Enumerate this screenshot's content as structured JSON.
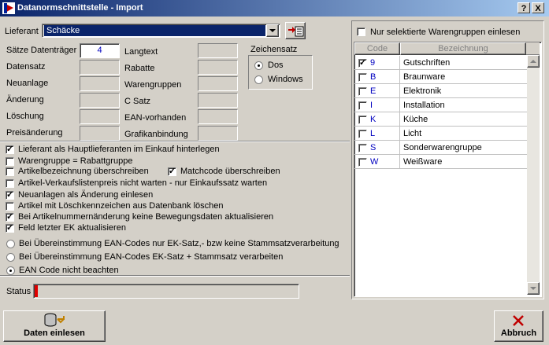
{
  "window": {
    "title": "Datanormschnittstelle - Import",
    "help": "?",
    "close": "X"
  },
  "supplier": {
    "label": "Lieferant",
    "value": "Schäcke"
  },
  "fields_left": [
    {
      "label": "Sätze Datenträger",
      "value": "4"
    },
    {
      "label": "Datensatz",
      "value": ""
    },
    {
      "label": "Neuanlage",
      "value": ""
    },
    {
      "label": "Änderung",
      "value": ""
    },
    {
      "label": "Löschung",
      "value": ""
    },
    {
      "label": "Preisänderung",
      "value": ""
    }
  ],
  "fields_right": [
    {
      "label": "Langtext",
      "value": ""
    },
    {
      "label": "Rabatte",
      "value": ""
    },
    {
      "label": "Warengruppen",
      "value": ""
    },
    {
      "label": "C Satz",
      "value": ""
    },
    {
      "label": "EAN-vorhanden",
      "value": ""
    },
    {
      "label": "Grafikanbindung",
      "value": ""
    }
  ],
  "charset": {
    "label": "Zeichensatz",
    "options": [
      "Dos",
      "Windows"
    ],
    "selected": "Dos"
  },
  "options": [
    {
      "label": "Lieferant als Hauptlieferanten im Einkauf hinterlegen",
      "checked": true
    },
    {
      "label": "Warengruppe = Rabattgruppe",
      "checked": false
    },
    {
      "label": "Artikelbezeichnung überschreiben",
      "checked": false
    },
    {
      "label": "Matchcode überschreiben",
      "checked": true
    },
    {
      "label": "Artikel-Verkaufslistenpreis nicht warten - nur Einkaufssatz warten",
      "checked": false
    },
    {
      "label": "Neuanlagen als Änderung einlesen",
      "checked": true
    },
    {
      "label": "Artikel mit Löschkennzeichen aus Datenbank löschen",
      "checked": false
    },
    {
      "label": "Bei Artikelnummernänderung keine Bewegungsdaten aktualisieren",
      "checked": true
    },
    {
      "label": "Feld letzter EK aktualisieren",
      "checked": true
    }
  ],
  "ean_options": [
    {
      "label": "Bei Übereinstimmung EAN-Codes nur EK-Satz,- bzw keine Stammsatzverarbeitung",
      "selected": false
    },
    {
      "label": "Bei Übereinstimmung EAN-Codes EK-Satz + Stammsatz verarbeiten",
      "selected": false
    },
    {
      "label": "EAN Code nicht beachten",
      "selected": true
    }
  ],
  "status": {
    "label": "Status",
    "value": ""
  },
  "buttons": {
    "read": "Daten einlesen",
    "cancel": "Abbruch"
  },
  "groups": {
    "filter_label": "Nur selektierte Warengruppen einlesen",
    "filter_checked": false,
    "col_code": "Code",
    "col_name": "Bezeichnung",
    "rows": [
      {
        "code": "9",
        "name": "Gutschriften",
        "checked": true
      },
      {
        "code": "B",
        "name": "Braunware",
        "checked": false
      },
      {
        "code": "E",
        "name": "Elektronik",
        "checked": false
      },
      {
        "code": "I",
        "name": "Installation",
        "checked": false
      },
      {
        "code": "K",
        "name": "Küche",
        "checked": false
      },
      {
        "code": "L",
        "name": "Licht",
        "checked": false
      },
      {
        "code": "S",
        "name": "Sonderwarengruppe",
        "checked": false
      },
      {
        "code": "W",
        "name": "Weißware",
        "checked": false
      }
    ]
  }
}
